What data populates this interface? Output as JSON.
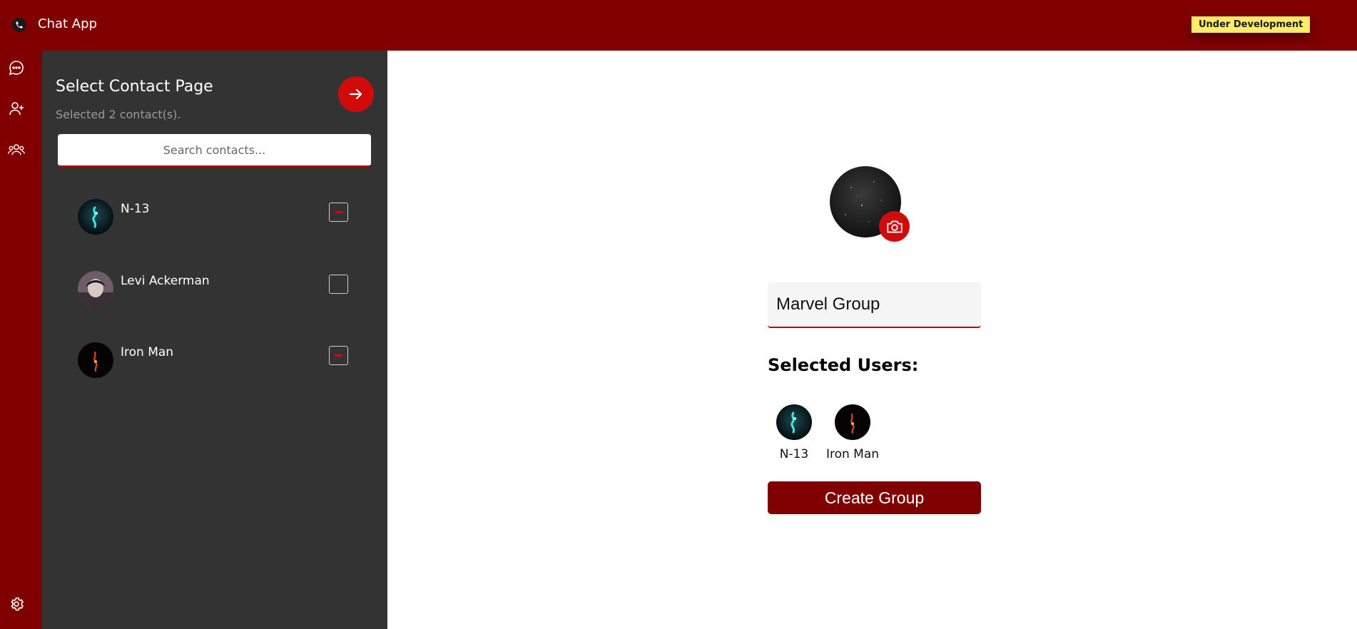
{
  "app": {
    "title": "Chat App",
    "badge": "Under Development"
  },
  "rail": {
    "icons": [
      "chat-icon",
      "add-user-icon",
      "group-icon",
      "settings-icon"
    ]
  },
  "contact_panel": {
    "title": "Select Contact Page",
    "subtitle": "Selected 2 contact(s).",
    "search_placeholder": "Search contacts...",
    "contacts": [
      {
        "name": "N-13",
        "selected": true
      },
      {
        "name": "Levi Ackerman",
        "selected": false
      },
      {
        "name": "Iron Man",
        "selected": true
      }
    ]
  },
  "group": {
    "name_value": "Marvel Group",
    "selected_title": "Selected Users:",
    "selected_users": [
      "N-13",
      "Iron Man"
    ],
    "create_label": "Create Group"
  },
  "colors": {
    "brand": "#800000",
    "accent": "#d10a0a",
    "panel": "#333333",
    "badge": "#ffeb6b"
  }
}
